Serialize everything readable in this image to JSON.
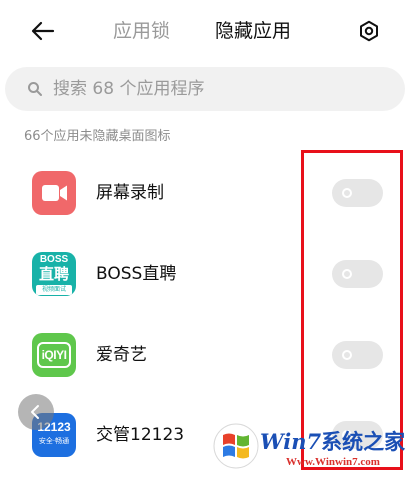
{
  "header": {
    "back_icon": "arrow-left-icon",
    "tabs": [
      {
        "label": "应用锁",
        "active": false
      },
      {
        "label": "隐藏应用",
        "active": true
      }
    ],
    "settings_icon": "gear-icon"
  },
  "search": {
    "placeholder": "搜索 68 个应用程序",
    "icon": "search-icon"
  },
  "section_label": "66个应用未隐藏桌面图标",
  "apps": [
    {
      "name": "屏幕录制",
      "icon": "screen-record-icon",
      "icon_color": "#f0686a",
      "hidden": false
    },
    {
      "name": "BOSS直聘",
      "icon": "boss-zhipin-icon",
      "icon_color": "#18b2a8",
      "icon_text_top": "BOSS",
      "icon_text_mid": "直聘",
      "icon_text_bottom": "视频面试",
      "hidden": false
    },
    {
      "name": "爱奇艺",
      "icon": "iqiyi-icon",
      "icon_color": "#5fc74c",
      "icon_text": "iQIYI",
      "hidden": false
    },
    {
      "name": "交管12123",
      "icon": "jiaoguan-icon",
      "icon_color": "#1d6fe0",
      "icon_text_top": "12123",
      "icon_text_bottom": "安全·畅通",
      "hidden": false
    }
  ],
  "highlight_color": "#e8101a",
  "watermark": {
    "logo": "windows-logo",
    "text_win": "Win",
    "text_7": "7",
    "text_cn": "系统之家",
    "url": "Www.Winwin7.com"
  }
}
